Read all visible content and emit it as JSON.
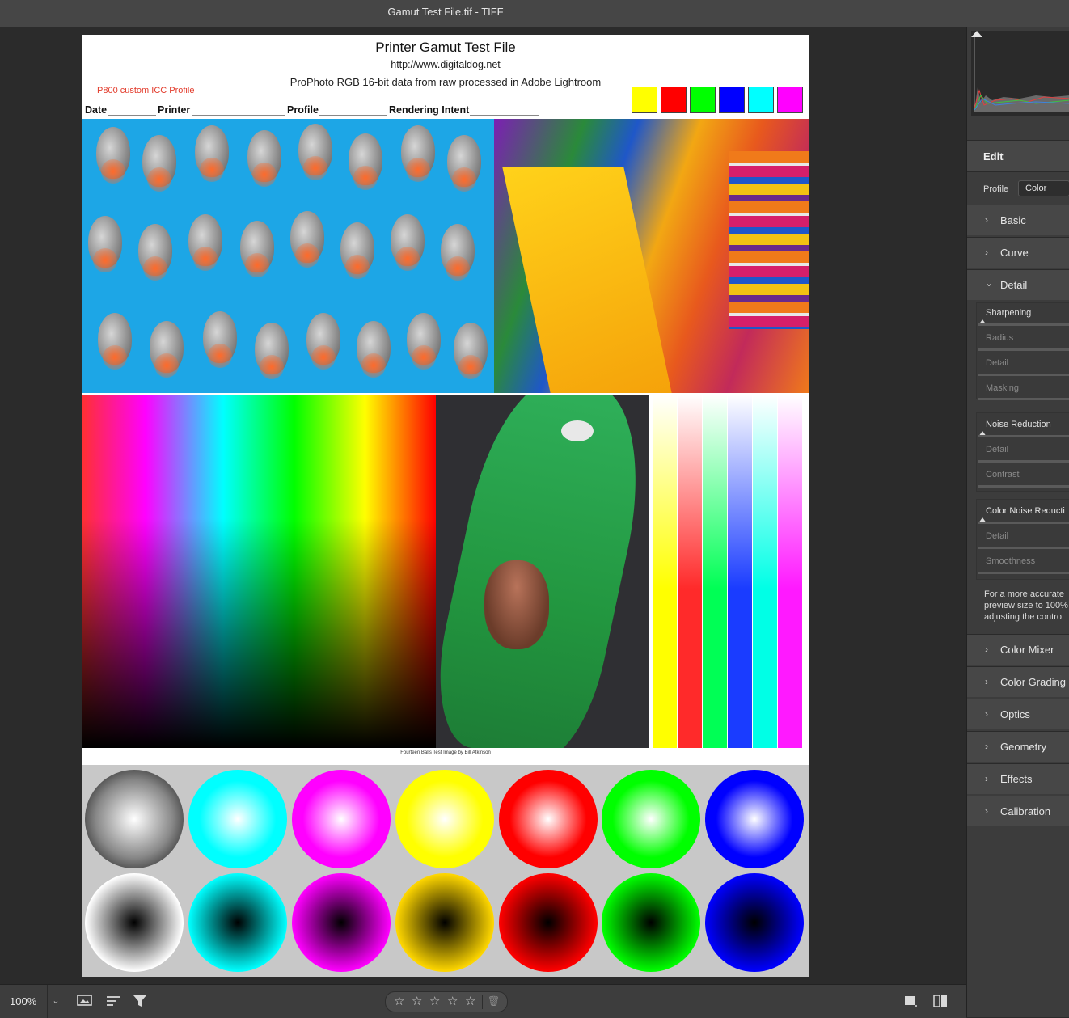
{
  "window": {
    "title": "Gamut Test File.tif  -  TIFF"
  },
  "document": {
    "title": "Printer Gamut Test File",
    "url": "http://www.digitaldog.net",
    "subtitle": "ProPhoto RGB 16-bit data from raw processed in Adobe Lightroom",
    "profile_note": "P800 custom ICC Profile",
    "fields": [
      "Date",
      "Printer",
      "Profile",
      "Rendering Intent"
    ],
    "swatch_colors": [
      "#ffff00",
      "#ff0000",
      "#00ff00",
      "#0000ff",
      "#00ffff",
      "#ff00ff"
    ],
    "credit": "Fourteen Balls Test Image by Bill Atkinson",
    "bar_colors": [
      "#ffff00",
      "#ff2a2a",
      "#00ff55",
      "#1a3cff",
      "#00ffe6",
      "#ff19ff"
    ],
    "balls_top": [
      "#000000",
      "#00ffff",
      "#ff00ff",
      "#ffff00",
      "#ff0000",
      "#00ff00",
      "#0000ff"
    ],
    "balls_bottom": [
      "#ffffff",
      "#00ffff",
      "#ff00ff",
      "#ffd700",
      "#ff0000",
      "#00ff00",
      "#0000ff"
    ]
  },
  "panel": {
    "edit_label": "Edit",
    "profile_label": "Profile",
    "profile_value": "Color",
    "sections_top": [
      "Basic",
      "Curve"
    ],
    "detail_label": "Detail",
    "sharpening": {
      "title": "Sharpening",
      "fields": [
        "Radius",
        "Detail",
        "Masking"
      ]
    },
    "noise": {
      "title": "Noise Reduction",
      "fields": [
        "Detail",
        "Contrast"
      ]
    },
    "color_noise": {
      "title": "Color Noise Reducti",
      "fields": [
        "Detail",
        "Smoothness"
      ]
    },
    "notice": [
      "For a more accurate",
      "preview size to 100%",
      "adjusting the contro"
    ],
    "sections_bottom": [
      "Color Mixer",
      "Color Grading",
      "Optics",
      "Geometry",
      "Effects",
      "Calibration"
    ]
  },
  "bottom": {
    "zoom": "100%",
    "zoom_caret": "⌄",
    "star_glyph": "☆",
    "rating_stars": 5,
    "trash_glyph": "🗑"
  }
}
